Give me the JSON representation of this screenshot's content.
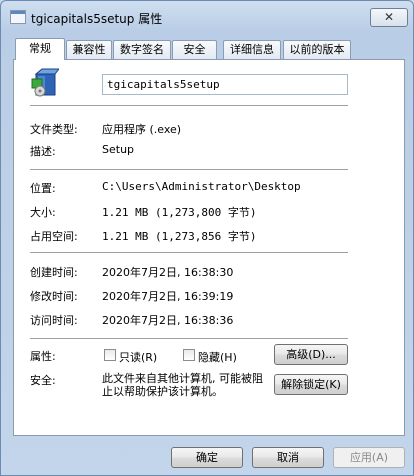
{
  "window": {
    "title": "tgicapitals5setup 属性",
    "close_glyph": "✕"
  },
  "tabs": [
    {
      "label": "常规"
    },
    {
      "label": "兼容性"
    },
    {
      "label": "数字签名"
    },
    {
      "label": "安全"
    },
    {
      "label": "详细信息"
    },
    {
      "label": "以前的版本"
    }
  ],
  "general": {
    "file_name": "tgicapitals5setup",
    "file_type_label": "文件类型:",
    "file_type_value": "应用程序 (.exe)",
    "description_label": "描述:",
    "description_value": "Setup",
    "location_label": "位置:",
    "location_value": "C:\\Users\\Administrator\\Desktop",
    "size_label": "大小:",
    "size_value": "1.21 MB (1,273,800 字节)",
    "size_on_disk_label": "占用空间:",
    "size_on_disk_value": "1.21 MB (1,273,856 字节)",
    "created_label": "创建时间:",
    "created_value": "2020年7月2日, 16:38:30",
    "modified_label": "修改时间:",
    "modified_value": "2020年7月2日, 16:39:19",
    "accessed_label": "访问时间:",
    "accessed_value": "2020年7月2日, 16:38:36",
    "attributes_label": "属性:",
    "readonly_label": "只读(R)",
    "hidden_label": "隐藏(H)",
    "advanced_button": "高级(D)...",
    "security_label": "安全:",
    "security_text": "此文件来自其他计算机, 可能被阻止以帮助保护该计算机。",
    "unblock_button": "解除锁定(K)"
  },
  "footer": {
    "ok": "确定",
    "cancel": "取消",
    "apply": "应用(A)"
  }
}
